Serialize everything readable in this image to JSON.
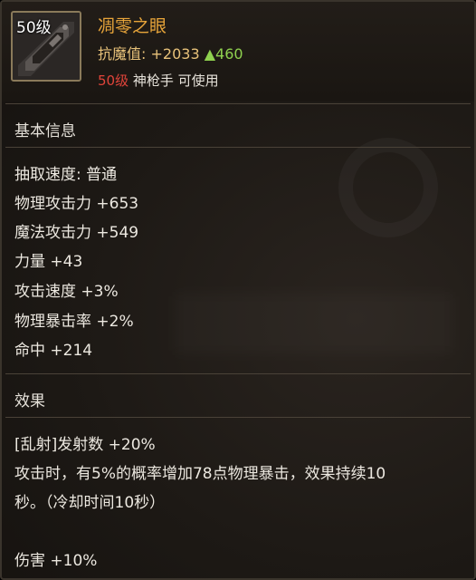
{
  "item": {
    "level_badge": "50级",
    "name": "凋零之眼",
    "stat_label": "抗魔值:",
    "stat_value": "+2033",
    "stat_increase": "▲460",
    "req_level": "50级",
    "req_text": "神枪手 可使用",
    "icon": "gun-weapon-icon"
  },
  "basic_info": {
    "title": "基本信息",
    "attributes": [
      "抽取速度: 普通",
      "物理攻击力 +653",
      "魔法攻击力 +549",
      "力量 +43",
      "攻击速度 +3%",
      "物理暴击率 +2%",
      "命中 +214"
    ]
  },
  "effects": {
    "title": "效果",
    "lines": [
      "[乱射]发射数 +20%",
      "攻击时，有5%的概率增加78点物理暴击，效果持续10",
      "秒。（冷却时间10秒）",
      "伤害 +10%"
    ]
  },
  "colors": {
    "name": "#e8a53a",
    "stat": "#e8c27a",
    "increase": "#8fd14f",
    "req_level": "#e0443a"
  }
}
